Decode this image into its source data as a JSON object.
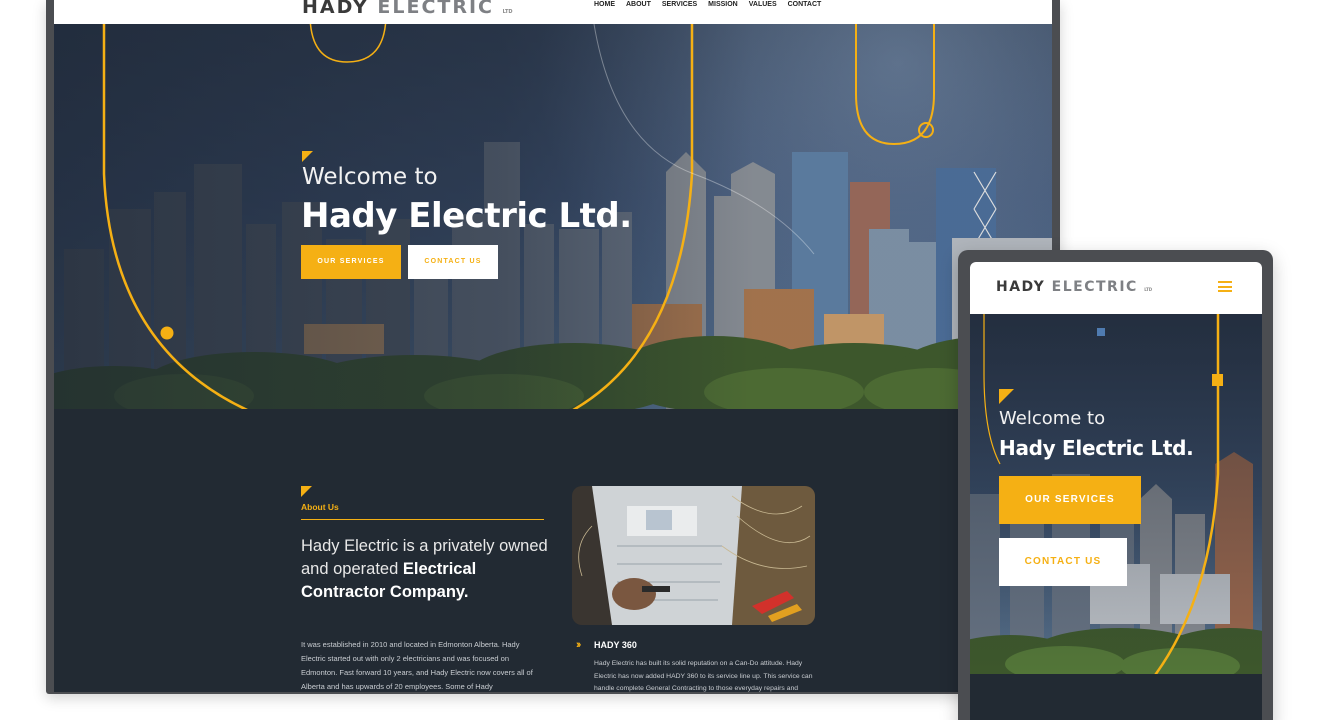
{
  "brand": {
    "logo_part1": "HADY",
    "logo_part2": "ELECTRIC",
    "logo_suffix": "LTD",
    "accent_color": "#f5b014",
    "dark_color": "#222a33"
  },
  "desktop": {
    "nav": [
      "HOME",
      "ABOUT",
      "SERVICES",
      "MISSION",
      "VALUES",
      "CONTACT"
    ],
    "hero": {
      "welcome": "Welcome to",
      "company": "Hady Electric Ltd.",
      "primary_button": "OUR SERVICES",
      "secondary_button": "CONTACT US"
    },
    "about": {
      "label": "About Us",
      "headline_regular": "Hady Electric is a privately owned and operated",
      "headline_bold": "Electrical Contractor Company.",
      "body": "It was established in 2010 and located in Edmonton Alberta. Hady Electric started out with only 2 electricians and was focused on Edmonton. Fast forward 10 years, and Hady Electric now covers all of Alberta and has upwards of 20 employees. Some of Hady",
      "hady360_title": "HADY 360",
      "hady360_body": "Hady Electric has built its solid reputation on a Can-Do attitude. Hady Electric has now added HADY 360 to its service line up. This service can handle complete General Contracting to those everyday repairs and"
    }
  },
  "mobile": {
    "menu_icon": "hamburger-menu-icon",
    "hero": {
      "welcome": "Welcome to",
      "company": "Hady Electric Ltd.",
      "primary_button": "OUR SERVICES",
      "secondary_button": "CONTACT US"
    }
  }
}
